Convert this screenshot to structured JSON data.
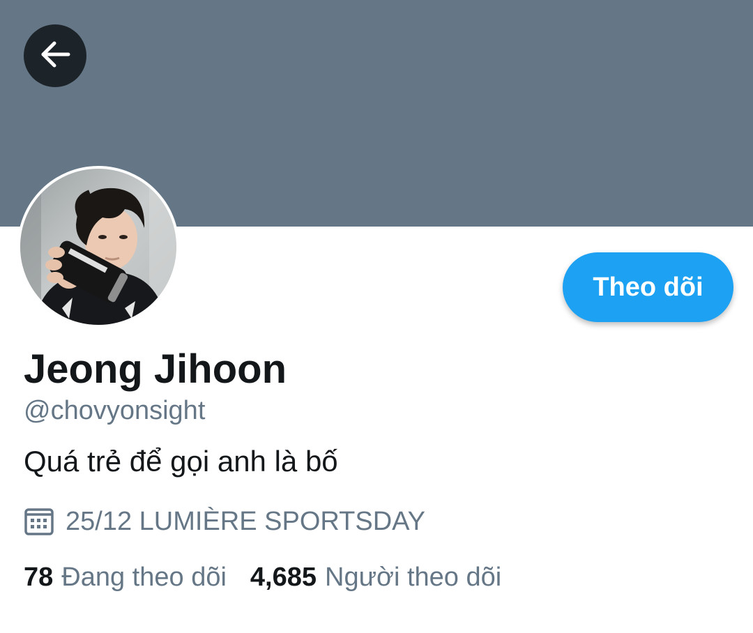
{
  "header": {
    "banner_color": "#657786",
    "back_icon": "arrow-left-icon"
  },
  "profile": {
    "avatar": "profile-photo",
    "display_name": "Jeong Jihoon",
    "handle": "@chovyonsight",
    "bio": "Quá trẻ để gọi anh là bố",
    "meta_icon": "calendar-icon",
    "meta_text": "25/12 LUMIÈRE SPORTSDAY"
  },
  "actions": {
    "follow_label": "Theo dõi",
    "accent": "#1da1f2"
  },
  "stats": {
    "following_count": "78",
    "following_label": "Đang theo dõi",
    "followers_count": "4,685",
    "followers_label": "Người theo dõi"
  }
}
